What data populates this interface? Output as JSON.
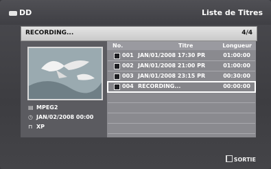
{
  "header": {
    "device": "DD",
    "title": "Liste de Titres"
  },
  "status": {
    "text": "RECORDING...",
    "page": "4/4"
  },
  "info": {
    "format": "MPEG2",
    "datetime": "JAN/02/2008 00:00",
    "quality": "XP"
  },
  "table": {
    "columns": {
      "no": "No.",
      "title": "Titre",
      "length": "Longueur"
    },
    "rows": [
      {
        "no": "001",
        "title": "JAN/01/2008 17:30 PR",
        "length": "01:00:00"
      },
      {
        "no": "002",
        "title": "JAN/01/2008 21:00 PR",
        "length": "01:00:00"
      },
      {
        "no": "003",
        "title": "JAN/01/2008 23:15 PR",
        "length": "00:30:00"
      },
      {
        "no": "004",
        "title": "RECORDING...",
        "length": "00:00:00"
      }
    ]
  },
  "footer": {
    "exit_label": "SORTIE"
  },
  "icons": {
    "device": "disc-drive-icon",
    "format": "film-strip-icon",
    "clock": "clock-icon",
    "quality": "lock-icon",
    "exit": "exit-icon"
  }
}
